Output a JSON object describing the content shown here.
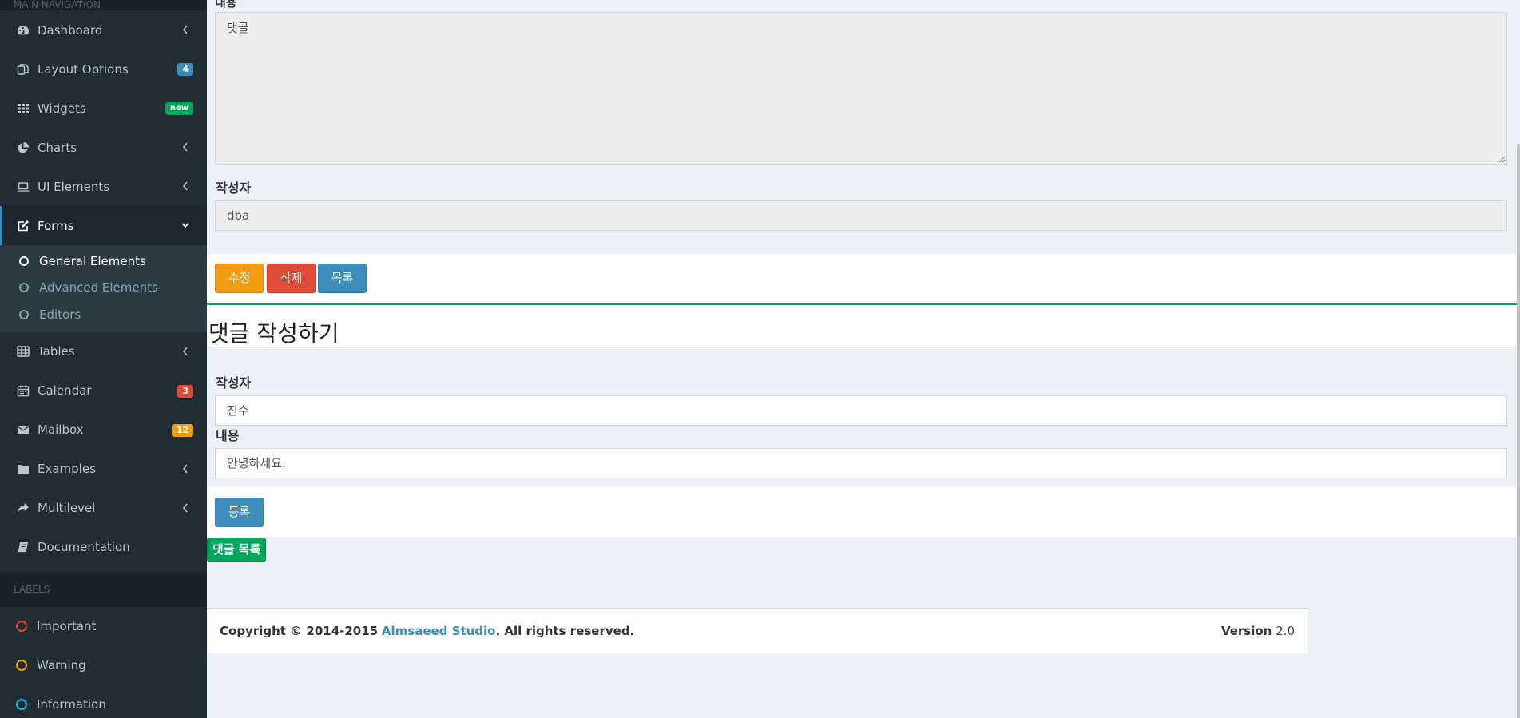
{
  "sidebar": {
    "main_header": "MAIN NAVIGATION",
    "items": [
      {
        "label": "Dashboard",
        "icon": "dashboard-icon"
      },
      {
        "label": "Layout Options",
        "icon": "files-icon",
        "badge": "4"
      },
      {
        "label": "Widgets",
        "icon": "th-icon",
        "badge": "new"
      },
      {
        "label": "Charts",
        "icon": "pie-chart-icon"
      },
      {
        "label": "UI Elements",
        "icon": "laptop-icon"
      },
      {
        "label": "Forms",
        "icon": "edit-icon"
      },
      {
        "label": "Tables",
        "icon": "table-icon"
      },
      {
        "label": "Calendar",
        "icon": "calendar-icon",
        "badge": "3"
      },
      {
        "label": "Mailbox",
        "icon": "envelope-icon",
        "badge": "12"
      },
      {
        "label": "Examples",
        "icon": "folder-icon"
      },
      {
        "label": "Multilevel",
        "icon": "share-icon"
      },
      {
        "label": "Documentation",
        "icon": "book-icon"
      }
    ],
    "forms_submenu": [
      {
        "label": "General Elements"
      },
      {
        "label": "Advanced Elements"
      },
      {
        "label": "Editors"
      }
    ],
    "labels_header": "LABELS",
    "labels": [
      {
        "label": "Important",
        "color": "#dd4b39"
      },
      {
        "label": "Warning",
        "color": "#f39c12"
      },
      {
        "label": "Information",
        "color": "#00c0ef"
      }
    ]
  },
  "board": {
    "content_label": "내용",
    "content_value": "댓글",
    "writer_label": "작성자",
    "writer_value": "dba",
    "buttons": {
      "modify": "수정",
      "remove": "삭제",
      "list": "목록"
    }
  },
  "reply_form": {
    "title": "댓글 작성하기",
    "writer_label": "작성자",
    "writer_value": "진수",
    "content_label": "내용",
    "content_value": "안녕하세요.",
    "submit": "등록"
  },
  "reply_list_button": "댓글 목록",
  "footer": {
    "copyright": "Copyright © 2014-2015",
    "brand": "Almsaeed Studio",
    "rights": ". All rights reserved.",
    "version_label": "Version",
    "version_value": "2.0"
  },
  "colors": {
    "sidebar": "#222d32",
    "primary": "#3c8dbc",
    "success": "#00a65a",
    "warning": "#f39c12",
    "danger": "#dd4b39"
  }
}
